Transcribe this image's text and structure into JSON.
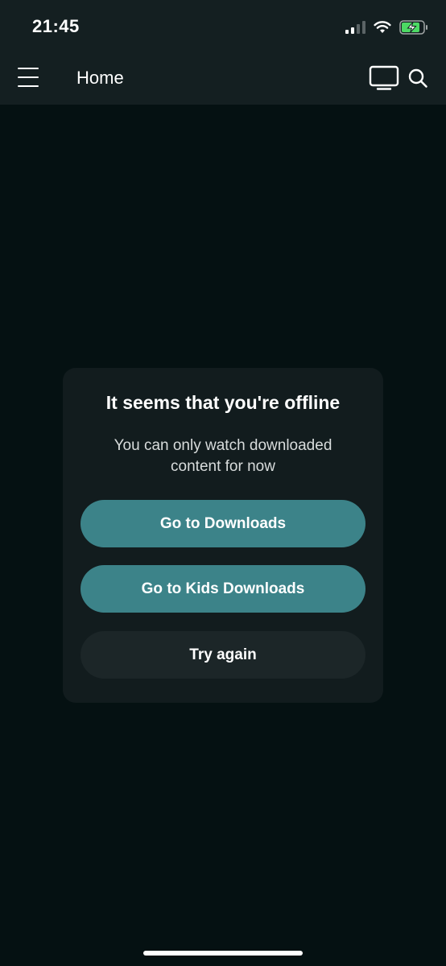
{
  "status_bar": {
    "time": "21:45",
    "icons": [
      "cellular-signal-icon",
      "wifi-icon",
      "battery-charging-icon"
    ]
  },
  "header": {
    "title": "Home",
    "icons": [
      "hamburger-menu-icon",
      "cast-tv-icon",
      "search-icon"
    ]
  },
  "offline_card": {
    "title": "It seems that you're offline",
    "message": "You can only watch downloaded content for now",
    "buttons": {
      "downloads": "Go to Downloads",
      "kids_downloads": "Go to Kids Downloads",
      "try_again": "Try again"
    }
  },
  "colors": {
    "background": "#051112",
    "header": "#141f21",
    "card": "#121c1e",
    "primary_button": "#3c8389",
    "secondary_button": "#1c2628",
    "battery_charge": "#4cd964"
  }
}
